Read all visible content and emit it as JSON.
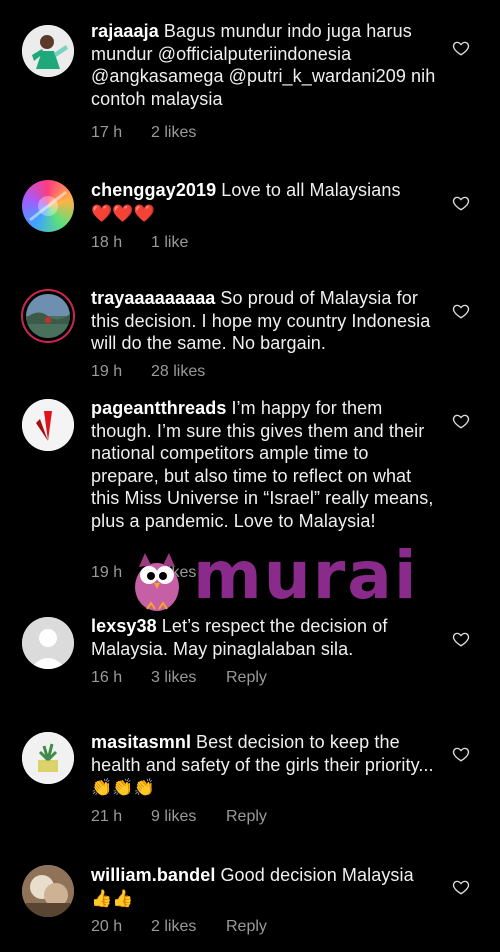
{
  "comments": [
    {
      "username": "rajaaaja",
      "text": "Bagus mundur indo juga harus mundur @officialputeriindonesia @angkasamega @putri_k_wardani209 nih contoh malaysia",
      "emoji": "",
      "time": "17 h",
      "likes": "2 likes",
      "reply": ""
    },
    {
      "username": "chenggay2019",
      "text": "Love to all Malaysians",
      "emoji": "❤️❤️❤️",
      "time": "18 h",
      "likes": "1 like",
      "reply": ""
    },
    {
      "username": "trayaaaaaaaaa",
      "text": "So proud of Malaysia for this decision. I hope my country Indonesia will do the same. No bargain.",
      "emoji": "",
      "time": "19 h",
      "likes": "28 likes",
      "reply": ""
    },
    {
      "username": "pageantthreads",
      "text": "I’m happy for them though. I’m sure this gives them and their national competitors ample time to prepare, but also time to reflect on what this Miss Universe in “Israel” really means, plus a pandemic. Love to Malaysia!",
      "emoji": "",
      "time": "19 h",
      "likes": "5 likes",
      "reply": ""
    },
    {
      "username": "lexsy38",
      "text": "Let’s respect the decision of Malaysia.  May pinaglalaban sila.",
      "emoji": "",
      "time": "16 h",
      "likes": "3 likes",
      "reply": "Reply"
    },
    {
      "username": "masitasmnl",
      "text": "Best decision to keep the health and safety of the girls their priority...",
      "emoji": "👏👏👏",
      "time": "21 h",
      "likes": "9 likes",
      "reply": "Reply"
    },
    {
      "username": "william.bandel",
      "text": "Good decision Malaysia",
      "emoji": "👍👍",
      "time": "20 h",
      "likes": "2 likes",
      "reply": "Reply"
    }
  ],
  "watermark": {
    "text": "murai"
  }
}
